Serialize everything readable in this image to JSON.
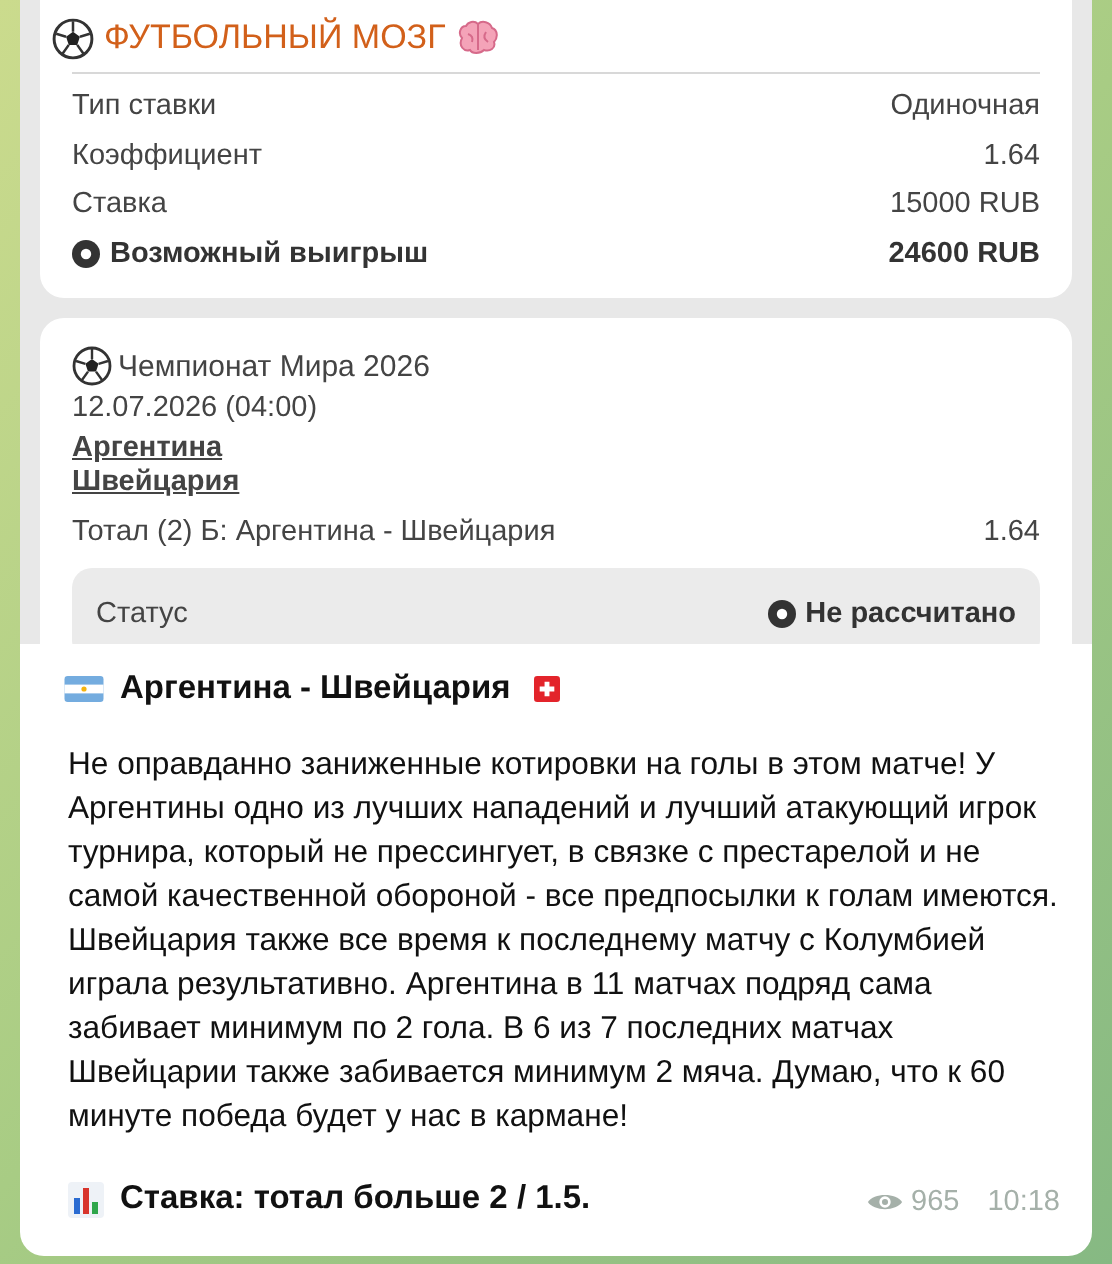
{
  "slip": {
    "brand": "ФУТБОЛЬНЫЙ МОЗГ",
    "summary": [
      {
        "label": "Тип ставки",
        "value": "Одиночная",
        "kind": "plain"
      },
      {
        "label": "Коэффициент",
        "value": "1.64",
        "kind": "plain"
      },
      {
        "label": "Ставка",
        "value": "15000 RUB",
        "kind": "plain"
      },
      {
        "label": "Возможный выигрыш",
        "value": "24600 RUB",
        "kind": "total"
      }
    ],
    "event": {
      "tournament": "Чемпионат Мира 2026",
      "datetime": "12.07.2026 (04:00)",
      "teams": [
        "Аргентина",
        "Швейцария"
      ],
      "market": "Тотал (2) Б: Аргентина - Швейцария",
      "odds": "1.64",
      "status_label": "Статус",
      "status": "Не рассчитано"
    }
  },
  "post": {
    "title": "Аргентина - Швейцария",
    "body": "Не оправданно заниженные котировки на голы в этом матче! У Аргентины одно из лучших нападений и лучший атакующий игрок турнира, который не прессингует, в связке с престарелой и не самой качественной обороной - все предпосылки к голам имеются. Швейцария также все время к последнему матчу с Колумбией играла результативно. Аргентина в 11 матчах подряд сама забивает минимум по 2 гола. В 6 из 7 последних матчах Швейцарии также забивается минимум 2 мяча. Думаю, что к 60 минуте победа будет у нас в кармане!",
    "bet": "Ставка: тотал больше 2 / 1.5.",
    "views": "965",
    "time": "10:18"
  }
}
